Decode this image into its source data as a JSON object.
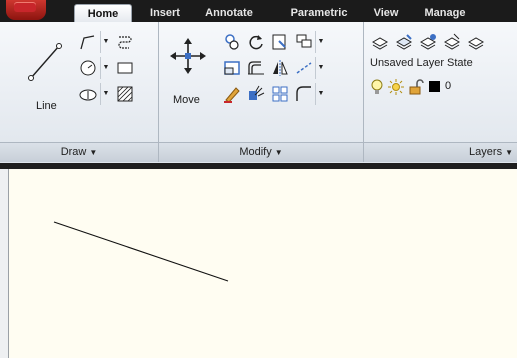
{
  "tabs": [
    "Home",
    "Insert",
    "Annotate",
    "Parametric",
    "View",
    "Manage"
  ],
  "active_tab": "Home",
  "panels": {
    "draw": {
      "title": "Draw",
      "line_label": "Line"
    },
    "modify": {
      "title": "Modify",
      "move_label": "Move"
    },
    "layers": {
      "title": "Layers",
      "layer_state": "Unsaved Layer State",
      "current_layer": "0"
    }
  },
  "colors": {
    "accent": "#c8262b",
    "tabbar": "#1b1b1b",
    "canvas": "#fffdf2"
  }
}
